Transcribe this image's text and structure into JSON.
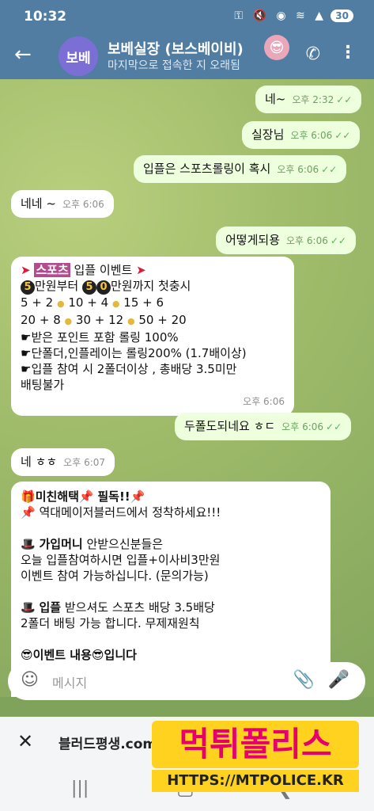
{
  "status": {
    "time": "10:32",
    "icons": "⚿ 🔇 ◉ ≋ ▲",
    "battery": "30"
  },
  "header": {
    "title": "보베실장 (보스베이비)",
    "subtitle": "마지막으로 접속한 지 오래됨",
    "avatar_text": "보베",
    "title_emoji": "😎"
  },
  "messages": [
    {
      "dir": "out",
      "text": "네~",
      "time": "오후 2:32"
    },
    {
      "dir": "out",
      "text": "실장님",
      "time": "오후 6:06"
    },
    {
      "dir": "out",
      "text": "입플은 스포츠롤링이 혹시",
      "time": "오후 6:06"
    },
    {
      "dir": "in",
      "text": "네네 ~",
      "time": "오후 6:06"
    },
    {
      "dir": "out",
      "text": "어떻게되용",
      "time": "오후 6:06"
    },
    {
      "dir": "in",
      "time": "오후 6:06",
      "lines": {
        "l1a": "스포츠",
        "l1b": "입플 이벤트",
        "l2a": "5",
        "l2b": "만원부터",
        "l2c": "5",
        "l2d": "0",
        "l2e": "만원까지 첫충시",
        "l3": "5 + 2",
        "l3b": "10 + 4",
        "l3c": "15 + 6",
        "l4": "20 + 8",
        "l4b": "30 + 12",
        "l4c": "50 + 20",
        "l5": "받은 포인트 포함 롤링 100%",
        "l6": "단폴더,인플레이는 롤링200% (1.7배이상)",
        "l7": "입플 참여 시 2폴더이상 , 총배당 3.5미만",
        "l8": "배팅불가"
      }
    },
    {
      "dir": "out",
      "text": "두폴도되네요 ㅎㄷ",
      "time": "오후 6:06"
    },
    {
      "dir": "in",
      "text": "네 ㅎㅎ",
      "time": "오후 6:07"
    },
    {
      "dir": "in",
      "lines": {
        "a1a": "미친해택",
        "a1b": "필독!!",
        "a2": "역대메이저블러드에서 정착하세요!!!",
        "b1a": "가입머니",
        "b1b": "안받으신분들은",
        "b2": "오늘 입플참여하시면 입플+이사비3만원",
        "b3": "이벤트 참여 가능하십니다. (문의가능)",
        "c1a": "입플",
        "c1b": "받으셔도 스포츠 배당 3.5배당",
        "c2": "2폴더 배팅 가능 합니다. 무제재원칙",
        "d1": "이벤트 내용",
        "d1b": "입니다"
      }
    }
  ],
  "input": {
    "placeholder": "메시지"
  },
  "browser": {
    "url": "블러드평생.com"
  },
  "watermark": {
    "big": "먹튀폴리스",
    "small": "HTTPS://MTPOLICE.KR"
  },
  "colors": {
    "header": "#517da2",
    "outgoing": "#eeffde",
    "incoming": "#ffffff",
    "check": "#5fb15a"
  }
}
